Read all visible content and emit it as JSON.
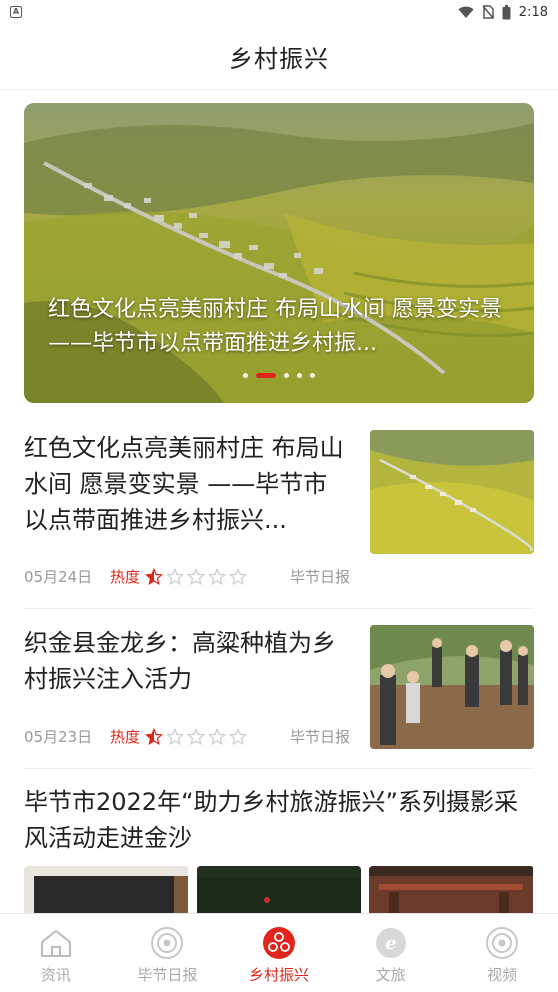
{
  "status_bar": {
    "app_icon": "A",
    "time": "2:18"
  },
  "header": {
    "title": "乡村振兴"
  },
  "banner": {
    "caption": "红色文化点亮美丽村庄 布局山水间 愿景变实景 ——毕节市以点带面推进乡村振...",
    "dots_total": 5,
    "active_dot": 1
  },
  "articles": [
    {
      "title": "红色文化点亮美丽村庄 布局山水间 愿景变实景 ——毕节市以点带面推进乡村振兴...",
      "date": "05月24日",
      "heat_label": "热度",
      "heat_rating": 0.5,
      "source": "毕节日报",
      "thumb_icon": "village-fields-photo"
    },
    {
      "title": "织金县金龙乡：高粱种植为乡村振兴注入活力",
      "date": "05月23日",
      "heat_label": "热度",
      "heat_rating": 0.5,
      "source": "毕节日报",
      "thumb_icon": "farmers-planting-photo"
    }
  ],
  "gallery_article": {
    "title": "毕节市2022年“助力乡村旅游振兴”系列摄影采风活动走进金沙"
  },
  "tabbar": {
    "tabs": [
      {
        "label": "资讯",
        "icon": "home-icon",
        "active": false
      },
      {
        "label": "毕节日报",
        "icon": "newspaper-circle-icon",
        "active": false
      },
      {
        "label": "乡村振兴",
        "icon": "rural-revival-icon",
        "active": true
      },
      {
        "label": "文旅",
        "icon": "culture-tourism-icon",
        "active": false
      },
      {
        "label": "视频",
        "icon": "video-circle-icon",
        "active": false
      }
    ]
  },
  "colors": {
    "accent": "#e0261a",
    "muted_text": "#999999",
    "tab_inactive": "#aaaaaa"
  }
}
